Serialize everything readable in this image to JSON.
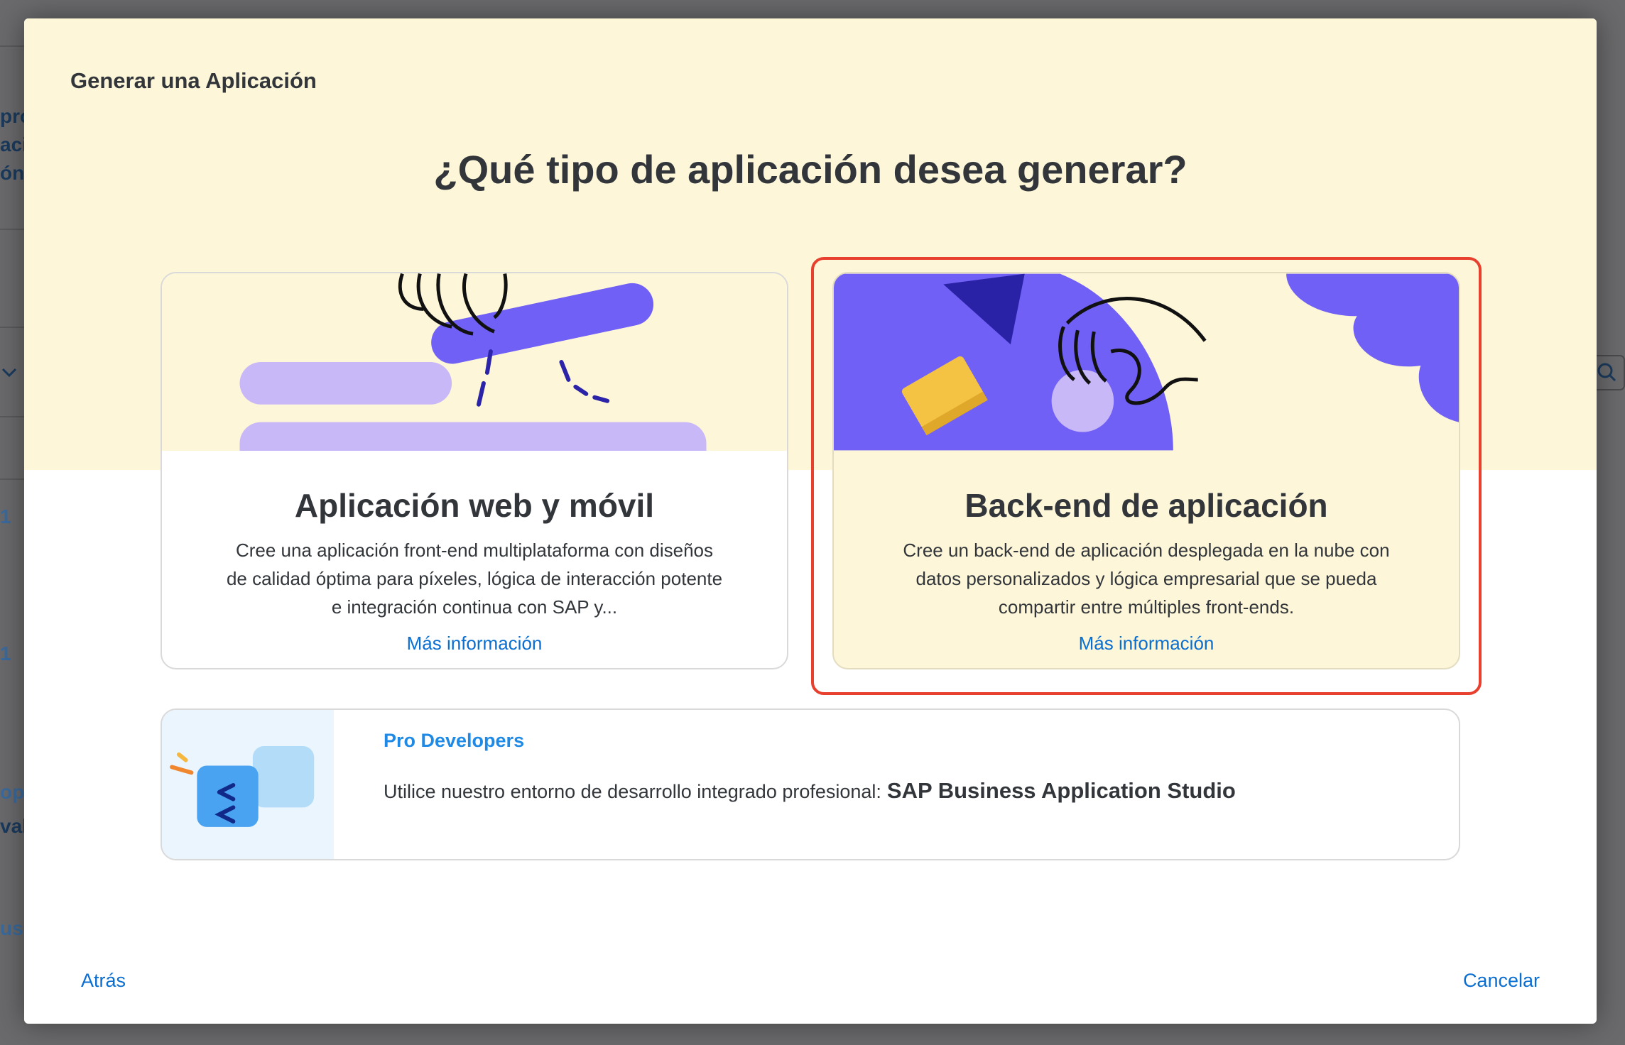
{
  "background": {
    "fragments": [
      "pro",
      "aci",
      "ón",
      "1",
      "1",
      "opr",
      "val",
      "use"
    ]
  },
  "dialog": {
    "title": "Generar una Aplicación",
    "question": "¿Qué tipo de aplicación desea generar?"
  },
  "cards": {
    "web": {
      "title": "Aplicación web y móvil",
      "description": "Cree una aplicación front-end multiplataforma con diseños de calidad óptima para píxeles, lógica de interacción potente e integración continua con SAP y...",
      "link": "Más información"
    },
    "backend": {
      "title": "Back-end de aplicación",
      "description": "Cree un back-end de aplicación desplegada en la nube con datos personalizados y lógica empresarial que se pueda compartir entre múltiples front-ends.",
      "link": "Más información"
    }
  },
  "pro": {
    "heading": "Pro Developers",
    "text": "Utilice nuestro entorno de desarrollo integrado profesional:",
    "studio": "SAP Business Application Studio"
  },
  "footer": {
    "back": "Atrás",
    "cancel": "Cancelar"
  },
  "colors": {
    "accent": "#0a6ed1",
    "hero_bg": "#fdf6d9",
    "illus_purple": "#7060f5",
    "illus_lilac": "#c9b8f8",
    "selection": "#e8402f"
  }
}
